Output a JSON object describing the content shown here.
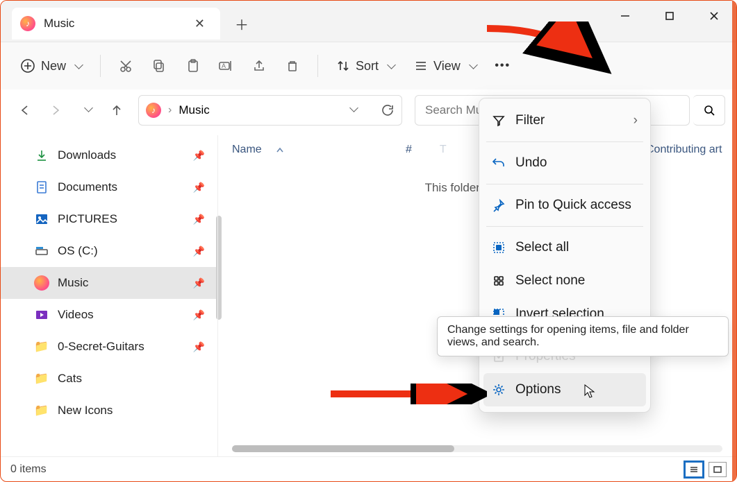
{
  "tab": {
    "title": "Music"
  },
  "toolbar": {
    "new_label": "New",
    "sort_label": "Sort",
    "view_label": "View",
    "more_label": "..."
  },
  "address": {
    "crumb": "Music",
    "separator": "›"
  },
  "search": {
    "placeholder": "Search Music"
  },
  "sidebar": {
    "items": [
      {
        "label": "Downloads",
        "icon": "download",
        "pinned": true,
        "selected": false
      },
      {
        "label": "Documents",
        "icon": "document",
        "pinned": true,
        "selected": false
      },
      {
        "label": "PICTURES",
        "icon": "pictures",
        "pinned": true,
        "selected": false
      },
      {
        "label": "OS (C:)",
        "icon": "drive",
        "pinned": true,
        "selected": false
      },
      {
        "label": "Music",
        "icon": "music",
        "pinned": true,
        "selected": true
      },
      {
        "label": "Videos",
        "icon": "videos",
        "pinned": true,
        "selected": false
      },
      {
        "label": "0-Secret-Guitars",
        "icon": "folder",
        "pinned": true,
        "selected": false
      },
      {
        "label": "Cats",
        "icon": "folder",
        "pinned": false,
        "selected": false
      },
      {
        "label": "New Icons",
        "icon": "folder",
        "pinned": false,
        "selected": false
      }
    ]
  },
  "columns": {
    "name": "Name",
    "hash": "#",
    "title": "Title",
    "contrib": "Contributing artists"
  },
  "content": {
    "empty_text": "This folder is empty."
  },
  "context_menu": {
    "filter": "Filter",
    "undo": "Undo",
    "pin": "Pin to Quick access",
    "select_all": "Select all",
    "select_none": "Select none",
    "invert": "Invert selection",
    "options": "Options",
    "properties": "Properties"
  },
  "tooltip": {
    "text": "Change settings for opening items, file and folder views, and search."
  },
  "status": {
    "text": "0 items"
  },
  "colors": {
    "accent": "#1b6ec2",
    "annotation": "#ed2f12"
  }
}
